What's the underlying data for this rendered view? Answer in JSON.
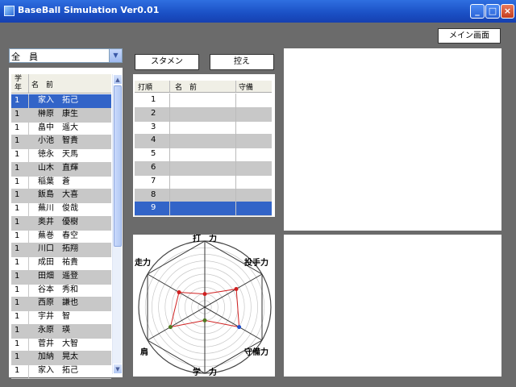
{
  "window": {
    "title": "BaseBall Simulation Ver0.01",
    "icon": "app-icon",
    "controls": [
      "minimize-icon",
      "maximize-icon",
      "close-icon"
    ]
  },
  "menu_button": {
    "label": "メイン画面"
  },
  "filter": {
    "value": "全　員",
    "icon": "chevron-down-icon"
  },
  "roster": {
    "headers": {
      "grade": "学年",
      "name": "名　前"
    },
    "rows": [
      {
        "grade": "1",
        "name": "家入　拓己"
      },
      {
        "grade": "1",
        "name": "榊原　康生"
      },
      {
        "grade": "1",
        "name": "畠中　遥大"
      },
      {
        "grade": "1",
        "name": "小池　智貴"
      },
      {
        "grade": "1",
        "name": "徳永　天馬"
      },
      {
        "grade": "1",
        "name": "山木　直輝"
      },
      {
        "grade": "1",
        "name": "稲葉　蒼"
      },
      {
        "grade": "1",
        "name": "飯島　大喜"
      },
      {
        "grade": "1",
        "name": "蕪川　俊哉"
      },
      {
        "grade": "1",
        "name": "奥井　優樹"
      },
      {
        "grade": "1",
        "name": "蕪巻　春空"
      },
      {
        "grade": "1",
        "name": "川口　拓翔"
      },
      {
        "grade": "1",
        "name": "成田　祐貴"
      },
      {
        "grade": "1",
        "name": "田畑　遥登"
      },
      {
        "grade": "1",
        "name": "谷本　秀和"
      },
      {
        "grade": "1",
        "name": "西原　謙也"
      },
      {
        "grade": "1",
        "name": "宇井　智"
      },
      {
        "grade": "1",
        "name": "永原　瑛"
      },
      {
        "grade": "1",
        "name": "菅井　大智"
      },
      {
        "grade": "1",
        "name": "加納　晃太"
      },
      {
        "grade": "1",
        "name": "家入　拓己"
      }
    ],
    "selected_index": 0
  },
  "tabs": {
    "starters": "スタメン",
    "bench": "控え"
  },
  "lineup": {
    "headers": {
      "order": "打順",
      "name": "名　前",
      "position": "守備"
    },
    "rows": [
      "1",
      "2",
      "3",
      "4",
      "5",
      "6",
      "7",
      "8",
      "9"
    ],
    "selected_index": 8
  },
  "radar": {
    "labels": [
      "打　力",
      "投手力",
      "守備力",
      "学　力",
      "肩",
      "走力"
    ],
    "values": [
      0.2,
      0.55,
      0.6,
      0.2,
      0.6,
      0.45
    ],
    "colors": {
      "outline": "#d02020",
      "marker": "#d02020",
      "marker_alt": "#2050d0",
      "marker_green": "#507a20"
    }
  }
}
